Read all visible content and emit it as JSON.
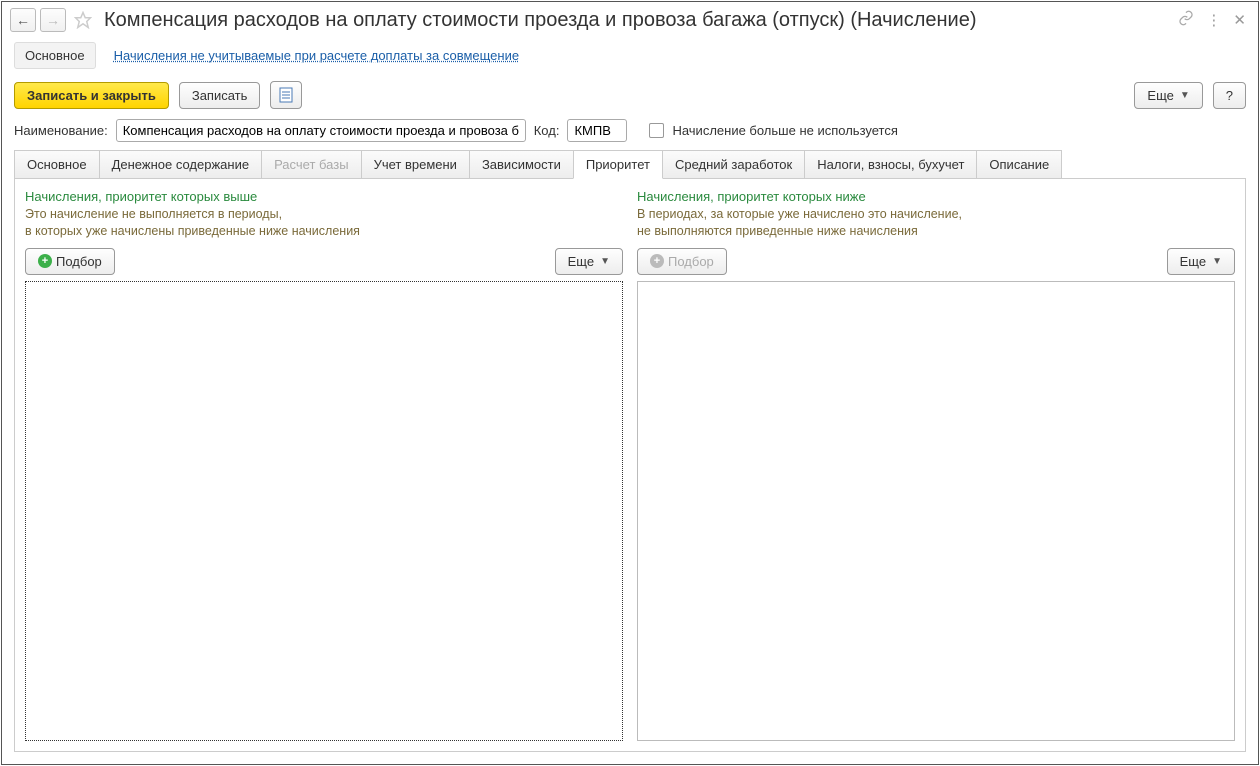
{
  "title": "Компенсация расходов на оплату стоимости проезда и провоза багажа (отпуск) (Начисление)",
  "sections": {
    "main": "Основное",
    "link": "Начисления не учитываемые при расчете доплаты за совмещение"
  },
  "toolbar": {
    "save_close": "Записать и закрыть",
    "save": "Записать",
    "more": "Еще",
    "help": "?"
  },
  "fields": {
    "name_label": "Наименование:",
    "name_value": "Компенсация расходов на оплату стоимости проезда и провоза баг",
    "code_label": "Код:",
    "code_value": "КМПВ",
    "not_used_label": "Начисление больше не используется"
  },
  "tabs": [
    {
      "label": "Основное",
      "active": false,
      "disabled": false
    },
    {
      "label": "Денежное содержание",
      "active": false,
      "disabled": false
    },
    {
      "label": "Расчет базы",
      "active": false,
      "disabled": true
    },
    {
      "label": "Учет времени",
      "active": false,
      "disabled": false
    },
    {
      "label": "Зависимости",
      "active": false,
      "disabled": false
    },
    {
      "label": "Приоритет",
      "active": true,
      "disabled": false
    },
    {
      "label": "Средний заработок",
      "active": false,
      "disabled": false
    },
    {
      "label": "Налоги, взносы, бухучет",
      "active": false,
      "disabled": false
    },
    {
      "label": "Описание",
      "active": false,
      "disabled": false
    }
  ],
  "panels": {
    "left": {
      "title": "Начисления, приоритет которых выше",
      "desc1": "Это начисление не выполняется в периоды,",
      "desc2": "в которых уже начислены приведенные ниже начисления",
      "pick": "Подбор",
      "more": "Еще"
    },
    "right": {
      "title": "Начисления, приоритет которых ниже",
      "desc1": "В периодах, за которые уже начислено это начисление,",
      "desc2": "не выполняются приведенные ниже начисления",
      "pick": "Подбор",
      "more": "Еще"
    }
  }
}
